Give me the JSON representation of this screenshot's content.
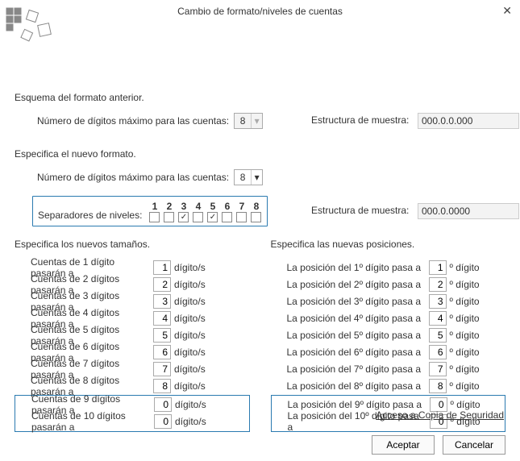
{
  "title": "Cambio de formato/niveles de cuentas",
  "close_glyph": "✕",
  "prev": {
    "heading": "Esquema del formato anterior.",
    "max_digits_label": "Número de dígitos máximo para las cuentas:",
    "max_digits": "8",
    "sample_label": "Estructura de muestra:",
    "sample": "000.0.0.000"
  },
  "newf": {
    "heading": "Especifica el nuevo formato.",
    "max_digits_label": "Número de dígitos máximo para las cuentas:",
    "max_digits": "8",
    "sep_label": "Separadores de niveles:",
    "sep_nums": [
      "1",
      "2",
      "3",
      "4",
      "5",
      "6",
      "7",
      "8"
    ],
    "sep_checked": [
      false,
      false,
      true,
      false,
      true,
      false,
      false,
      false
    ],
    "sample_label": "Estructura de muestra:",
    "sample": "000.0.0000"
  },
  "sizes": {
    "heading": "Especifica los nuevos tamaños.",
    "rows": [
      {
        "label": "Cuentas de 1 dígito pasarán a",
        "value": "1"
      },
      {
        "label": "Cuentas de 2 dígitos pasarán a",
        "value": "2"
      },
      {
        "label": "Cuentas de 3 dígitos pasarán a",
        "value": "3"
      },
      {
        "label": "Cuentas de 4 dígitos pasarán a",
        "value": "4"
      },
      {
        "label": "Cuentas de 5 dígitos pasarán a",
        "value": "5"
      },
      {
        "label": "Cuentas de 6 dígitos pasarán a",
        "value": "6"
      },
      {
        "label": "Cuentas de 7 dígitos pasarán a",
        "value": "7"
      },
      {
        "label": "Cuentas de 8 dígitos pasarán a",
        "value": "8"
      }
    ],
    "hi_rows": [
      {
        "label": "Cuentas de 9 dígitos pasarán a",
        "value": "0"
      },
      {
        "label": "Cuentas de 10 dígitos pasarán a",
        "value": "0"
      }
    ],
    "suffix": "dígito/s"
  },
  "positions": {
    "heading": "Especifica las nuevas posiciones.",
    "rows": [
      {
        "label": "La posición del 1º dígito pasa a",
        "value": "1"
      },
      {
        "label": "La posición del 2º dígito pasa a",
        "value": "2"
      },
      {
        "label": "La posición del 3º dígito pasa a",
        "value": "3"
      },
      {
        "label": "La posición del 4º dígito pasa a",
        "value": "4"
      },
      {
        "label": "La posición del 5º dígito pasa a",
        "value": "5"
      },
      {
        "label": "La posición del 6º dígito pasa a",
        "value": "6"
      },
      {
        "label": "La posición del 7º dígito pasa a",
        "value": "7"
      },
      {
        "label": "La posición del 8º dígito pasa a",
        "value": "8"
      }
    ],
    "hi_rows": [
      {
        "label": "La posición del 9º dígito pasa a",
        "value": "0"
      },
      {
        "label": "La posición del 10º dígito pasa a",
        "value": "0"
      }
    ],
    "suffix": "º dígito"
  },
  "backup_link": "Acceso a Copia de Seguridad",
  "buttons": {
    "ok": "Aceptar",
    "cancel": "Cancelar"
  }
}
